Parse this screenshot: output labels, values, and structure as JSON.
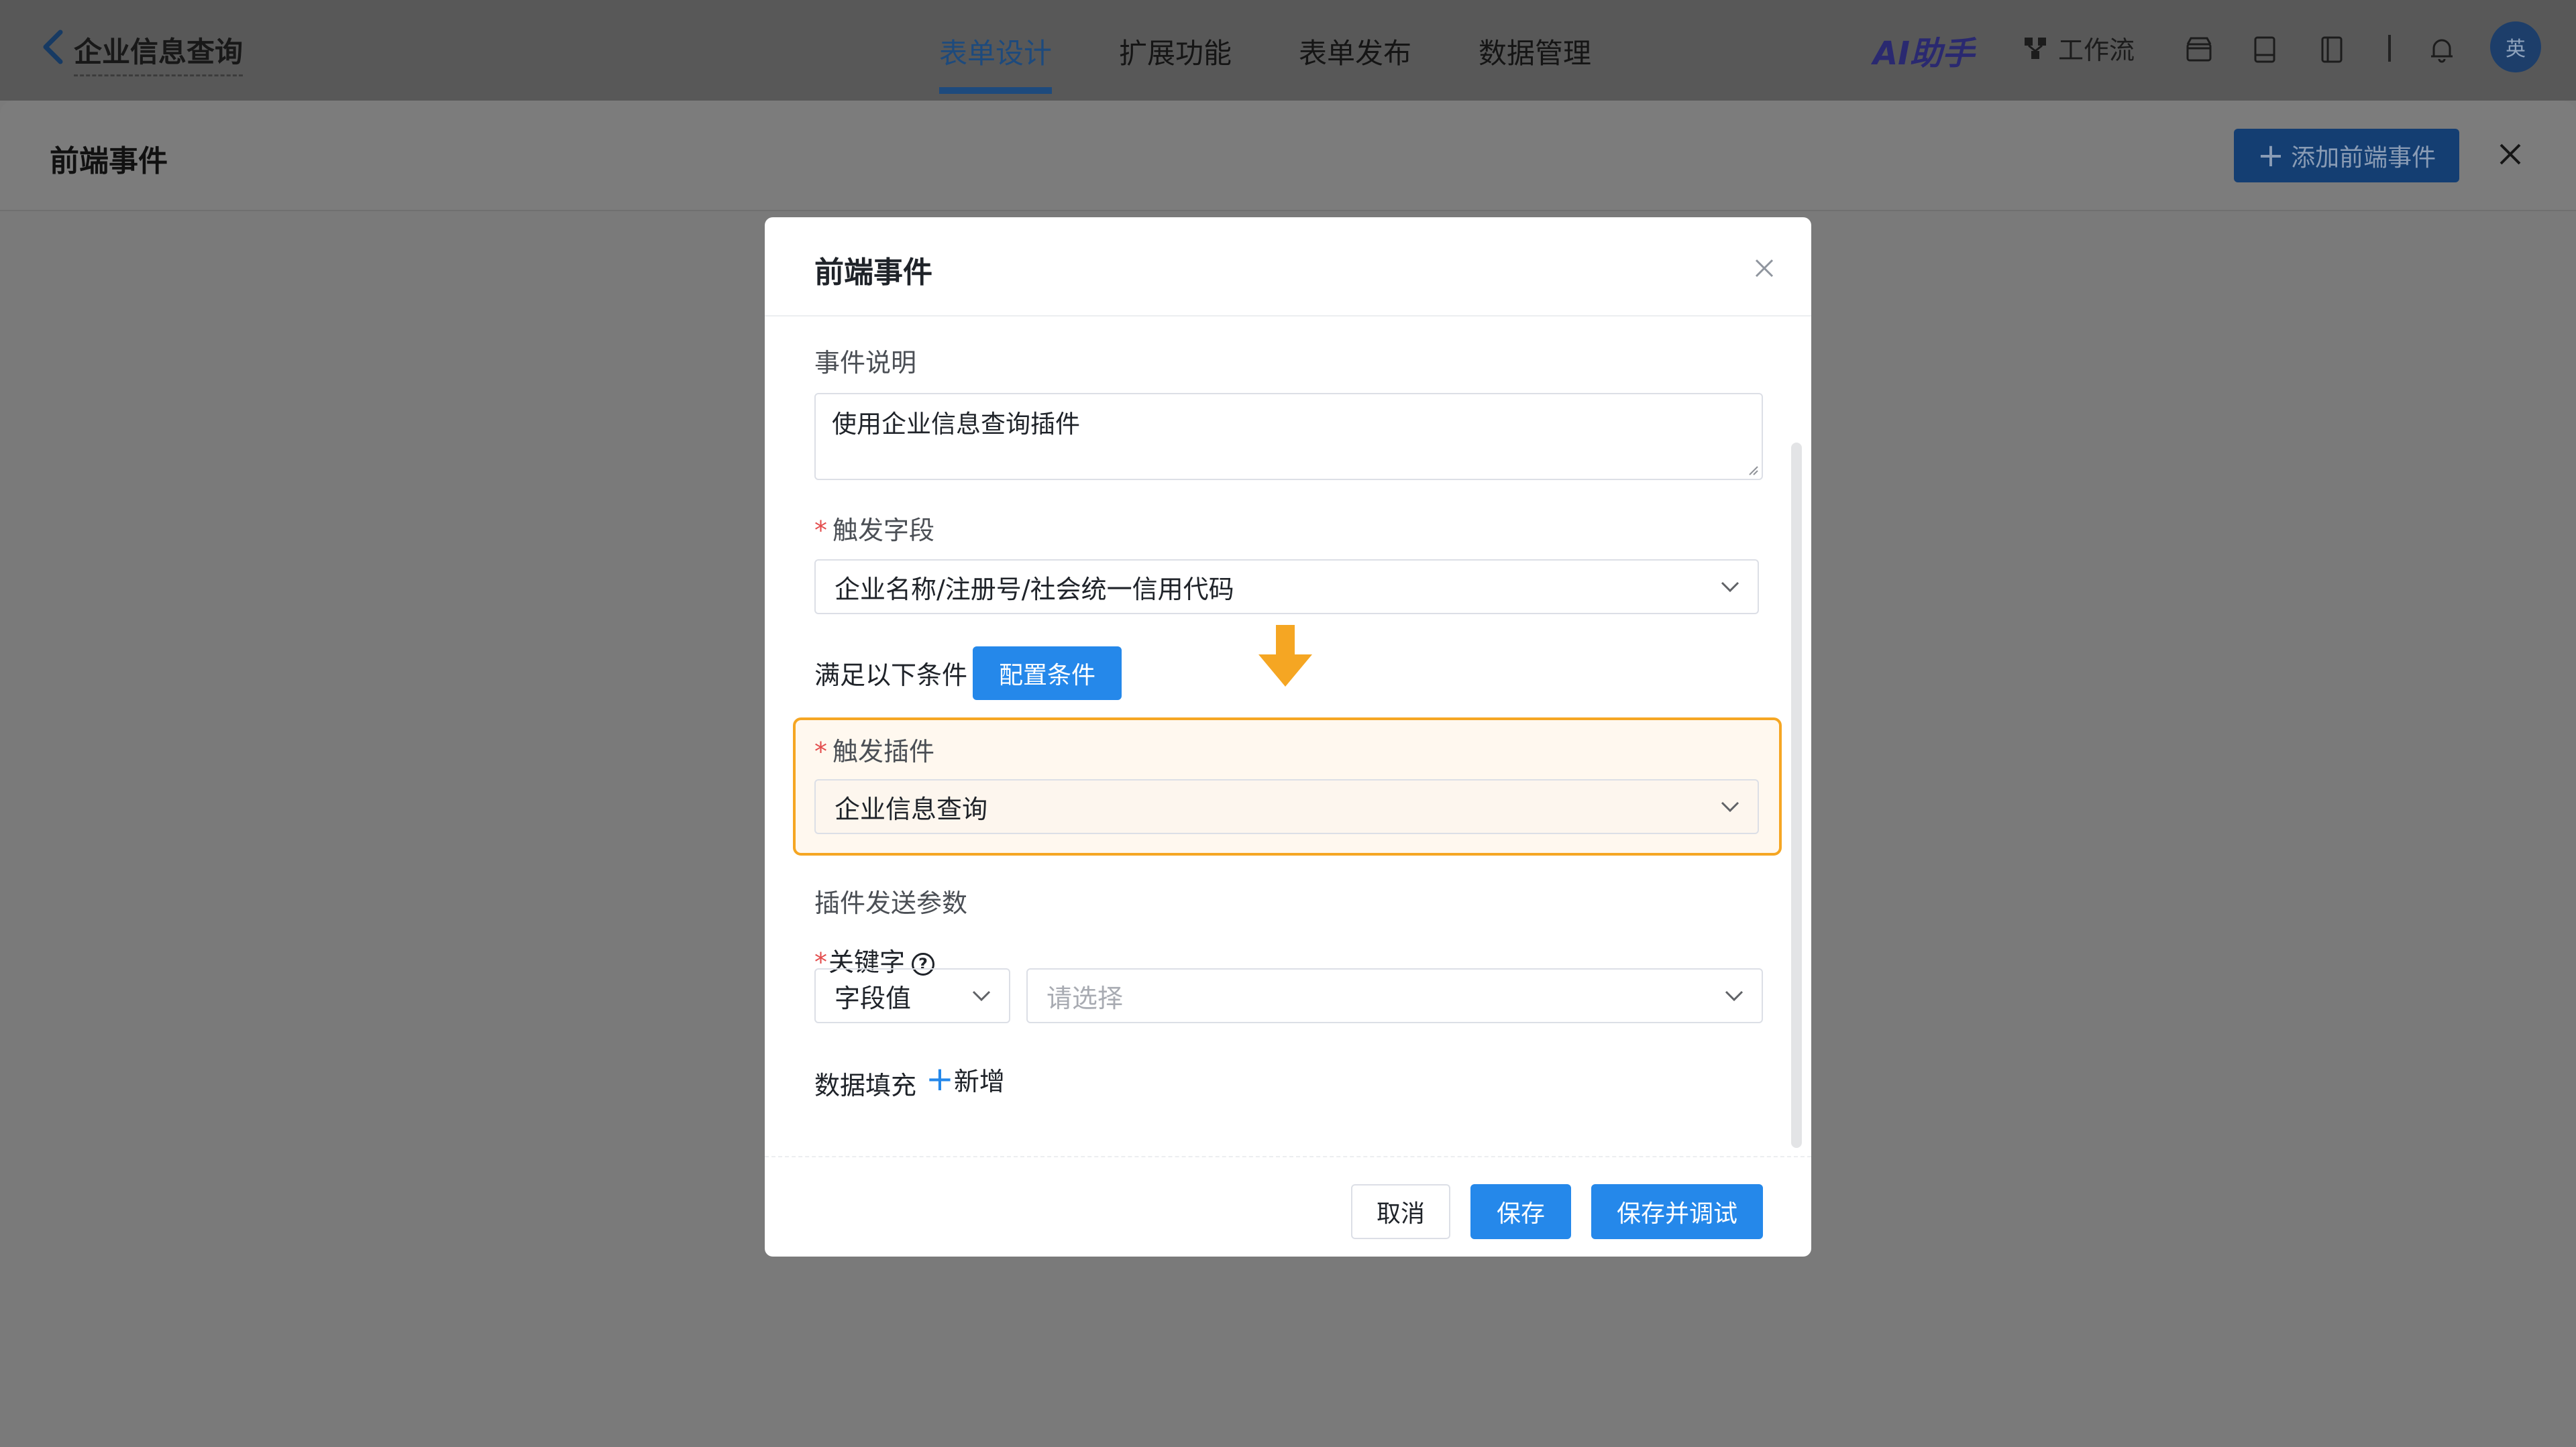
{
  "header": {
    "app_title": "企业信息查询",
    "tabs": [
      {
        "label": "表单设计",
        "active": true
      },
      {
        "label": "扩展功能",
        "active": false
      },
      {
        "label": "表单发布",
        "active": false
      },
      {
        "label": "数据管理",
        "active": false
      }
    ],
    "ai_label": "AI助手",
    "workflow_label": "工作流",
    "avatar_text": "英"
  },
  "drawer": {
    "title": "前端事件",
    "add_button": "添加前端事件"
  },
  "modal": {
    "title": "前端事件",
    "event_desc_label": "事件说明",
    "event_desc_value": "使用企业信息查询插件",
    "trigger_field_label": "触发字段",
    "trigger_field_value": "企业名称/注册号/社会统一信用代码",
    "condition_label": "满足以下条件",
    "condition_button": "配置条件",
    "trigger_plugin_label": "触发插件",
    "trigger_plugin_value": "企业信息查询",
    "plugin_params_label": "插件发送参数",
    "keyword_label": "关键字",
    "keyword_type_value": "字段值",
    "keyword_value_placeholder": "请选择",
    "data_fill_label": "数据填充",
    "add_new_label": "新增",
    "cancel_button": "取消",
    "save_button": "保存",
    "save_debug_button": "保存并调试"
  },
  "colors": {
    "primary": "#2588ea",
    "highlight": "#f5a623",
    "required": "#e34d4d"
  }
}
